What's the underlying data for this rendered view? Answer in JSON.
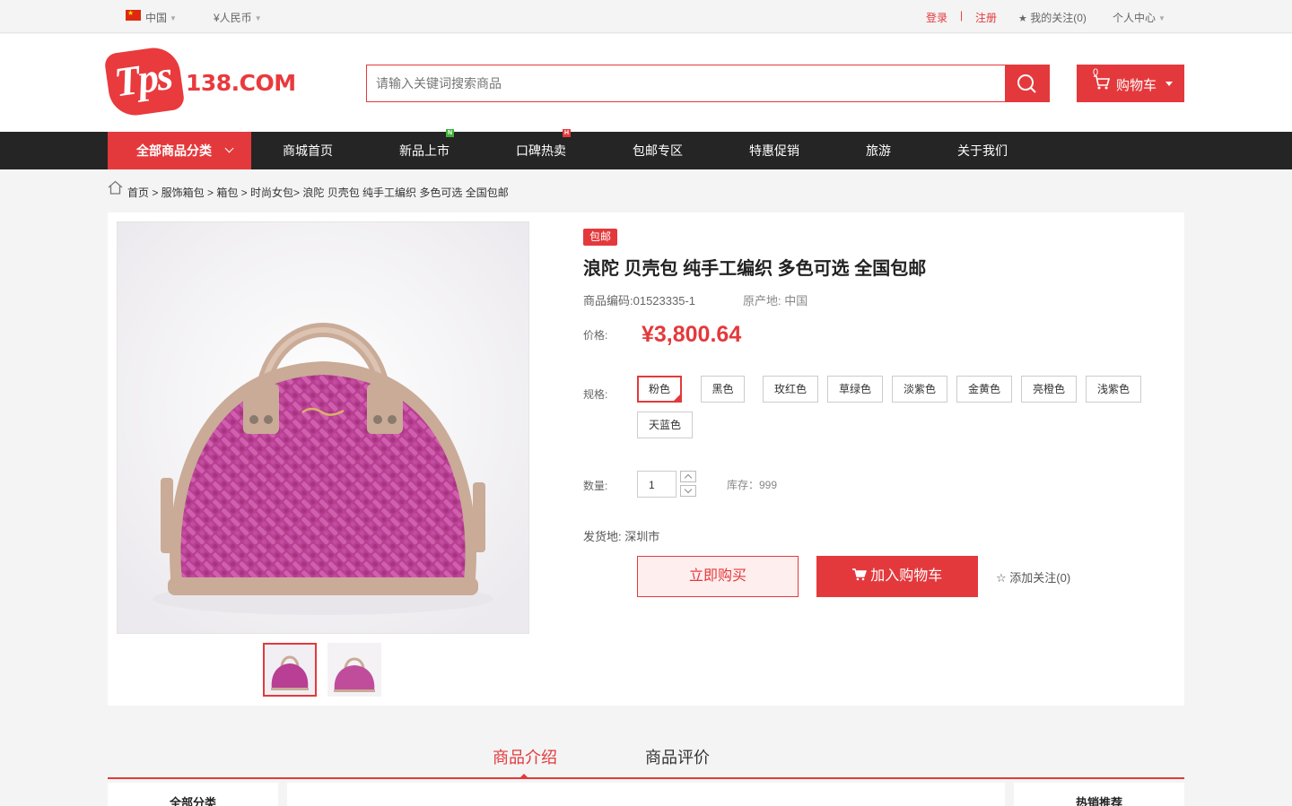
{
  "topbar": {
    "country": "中国",
    "currency": "¥人民币",
    "login": "登录",
    "separator": "|",
    "register": "注册",
    "my_follow": "我的关注(0)",
    "user_center": "个人中心"
  },
  "header": {
    "logo_badge": "Tps",
    "logo_text": "138.COM",
    "search_placeholder": "请输入关键词搜索商品",
    "cart_label": "购物车",
    "cart_count": "0"
  },
  "nav": {
    "all_categories": "全部商品分类",
    "items": [
      "商城首页",
      "新品上市",
      "口碑热卖",
      "包邮专区",
      "特惠促销",
      "旅游",
      "关于我们"
    ],
    "tag_new": "N",
    "tag_hot": "H"
  },
  "breadcrumb": "首页 > 服饰箱包 > 箱包 > 时尚女包> 浪陀 贝壳包 纯手工编织 多色可选 全国包邮",
  "product": {
    "badge": "包邮",
    "title": "浪陀 贝壳包 纯手工编织 多色可选 全国包邮",
    "code": "商品编码:01523335-1",
    "origin": "原产地: 中国",
    "price_label": "价格:",
    "price": "¥3,800.64",
    "spec_label": "规格:",
    "specs": [
      "粉色",
      "黑色",
      "玫红色",
      "草绿色",
      "淡紫色",
      "金黄色",
      "亮橙色",
      "浅紫色",
      "天蓝色"
    ],
    "selected_spec": "粉色",
    "qty_label": "数量:",
    "qty": "1",
    "stock": "库存：999",
    "ship_from": "发货地: 深圳市",
    "buy_now": "立即购买",
    "add_cart": "加入购物车",
    "add_follow": "添加关注(0)"
  },
  "tabs": [
    "商品介绍",
    "商品评价"
  ],
  "sidebar_left_title": "全部分类",
  "sidebar_right_title": "热销推荐",
  "colors": {
    "accent": "#e4393c",
    "nav_bg": "#252525",
    "bag": "#b83f93",
    "trim": "#c9ab97"
  }
}
